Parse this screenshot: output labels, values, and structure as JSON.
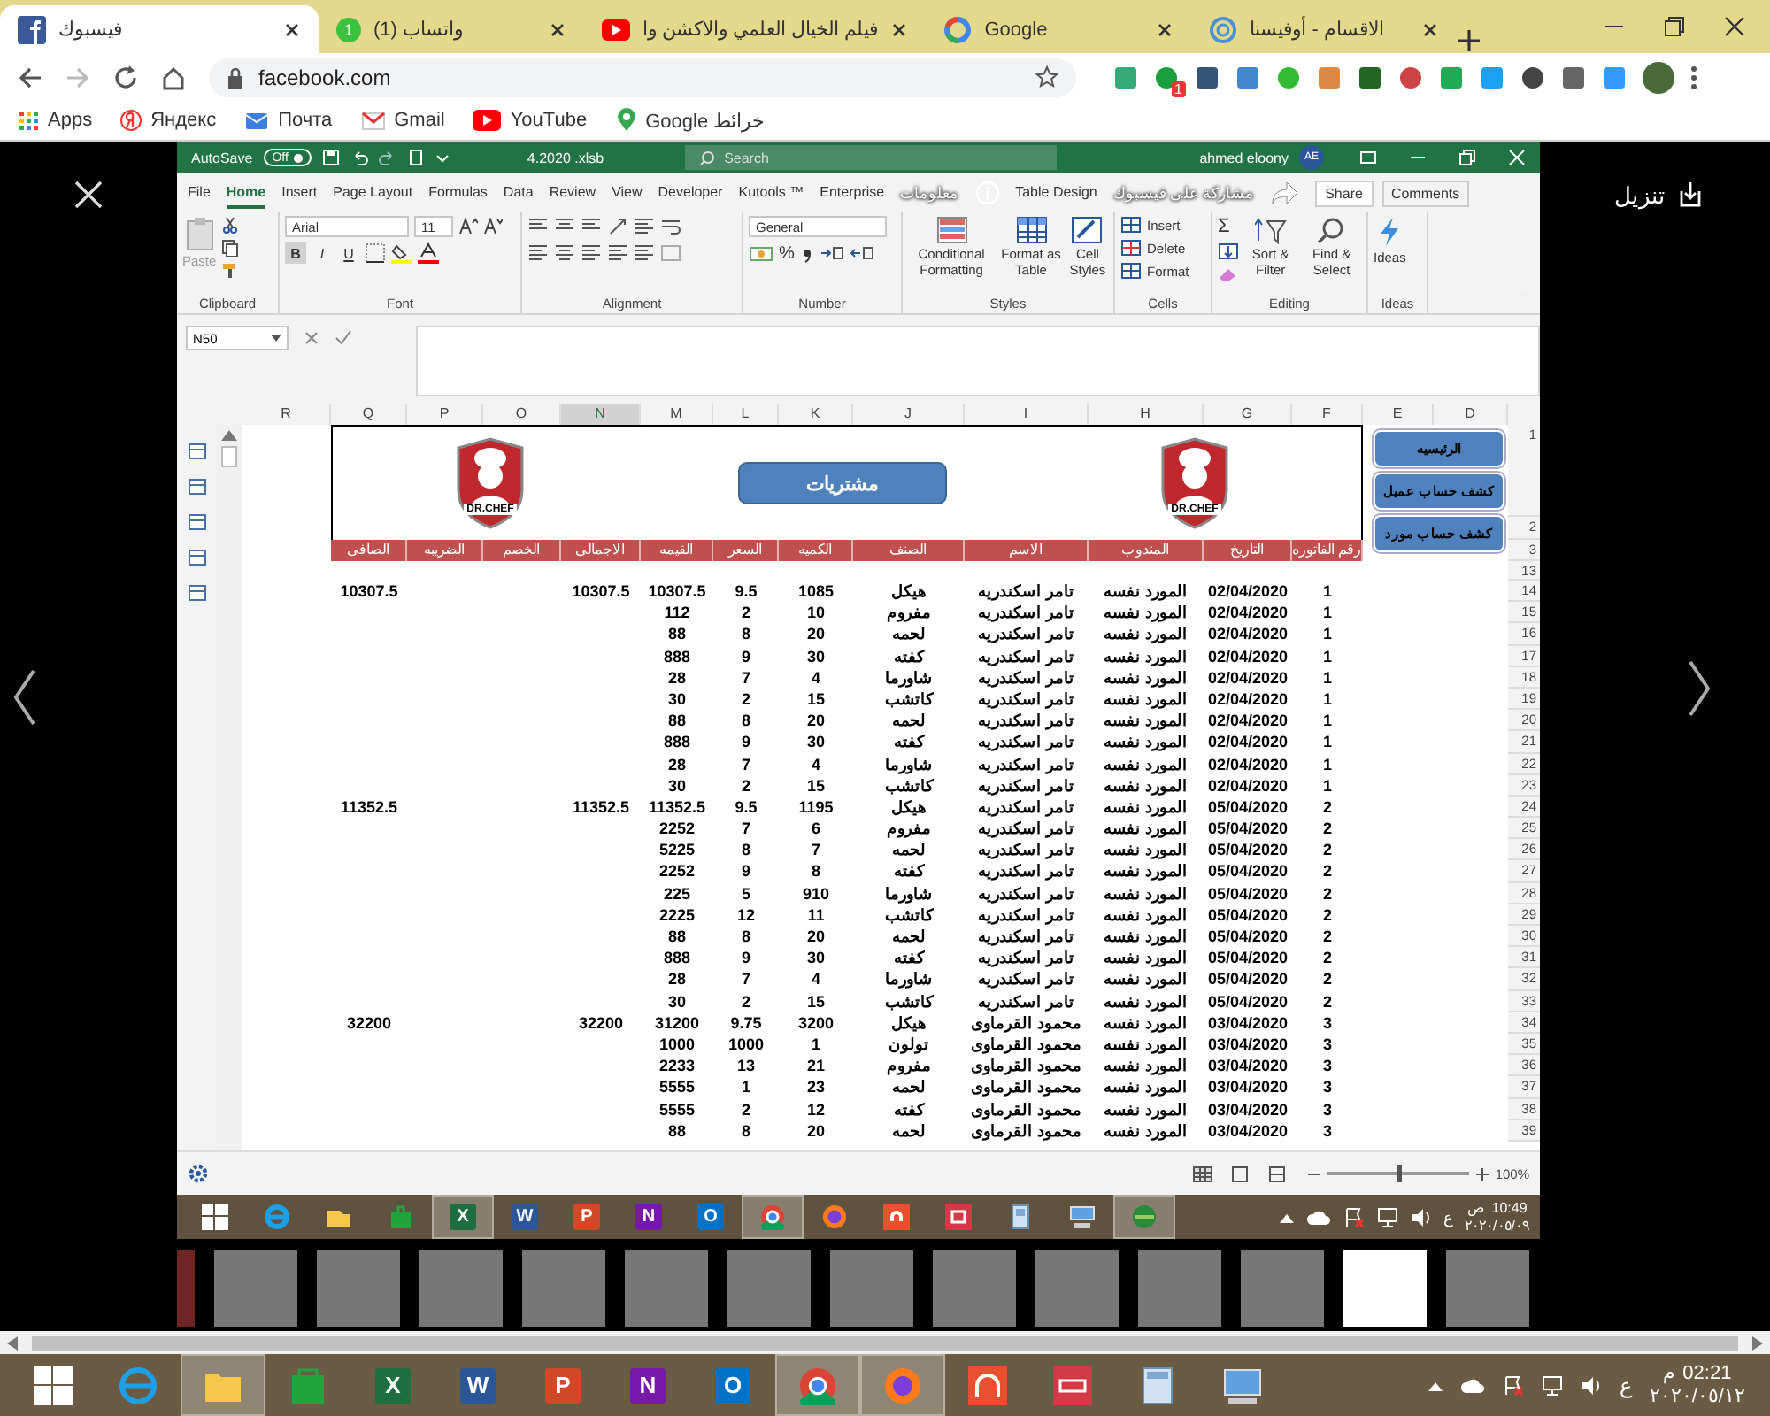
{
  "browser": {
    "tabs": [
      {
        "title": "الاقسام - أوفيسنا",
        "kind": "spiral",
        "selected": false
      },
      {
        "title": "Google",
        "kind": "ring",
        "selected": false
      },
      {
        "title": "فيلم الخيال العلمي والاكشن وا",
        "kind": "play",
        "selected": false
      },
      {
        "title": "(1) واتساب",
        "kind": "badge",
        "badge": "1",
        "selected": false
      },
      {
        "title": "فيسبوك",
        "kind": "square",
        "selected": true
      }
    ],
    "address": "facebook.com",
    "extension_badge": "1",
    "bookmarks": [
      {
        "label": "Google خرائط",
        "kind": "pin"
      },
      {
        "label": "YouTube",
        "kind": "play"
      },
      {
        "label": "Gmail",
        "kind": "gmail"
      },
      {
        "label": "Почта",
        "kind": "mail"
      },
      {
        "label": "Яндекс",
        "kind": "ya"
      },
      {
        "label": "Apps",
        "kind": "grid"
      }
    ]
  },
  "viewer": {
    "download": "تنزيل",
    "info": "معلومات",
    "share": "مشاركة على فيسبوك",
    "thumbnails": [
      {
        "selected": false
      },
      {
        "selected": false
      },
      {
        "selected": false
      },
      {
        "selected": false
      },
      {
        "selected": false
      },
      {
        "selected": false
      },
      {
        "selected": false
      },
      {
        "selected": false
      },
      {
        "selected": false
      },
      {
        "selected": false
      },
      {
        "selected": false
      },
      {
        "selected": false
      },
      {
        "selected": true
      },
      {
        "selected": false
      }
    ]
  },
  "excel": {
    "title_bar": {
      "autosave": "AutoSave",
      "autosave_state": "Off",
      "file": "4.2020 .xlsb",
      "search": "Search",
      "user": "ahmed eloony",
      "initials": "AE"
    },
    "tabs": [
      {
        "label": "Table Design",
        "selected": false
      },
      {
        "label": "Enterprise",
        "selected": false
      },
      {
        "label": "Kutools ™",
        "selected": false
      },
      {
        "label": "Developer",
        "selected": false
      },
      {
        "label": "View",
        "selected": false
      },
      {
        "label": "Review",
        "selected": false
      },
      {
        "label": "Data",
        "selected": false
      },
      {
        "label": "Formulas",
        "selected": false
      },
      {
        "label": "Page Layout",
        "selected": false
      },
      {
        "label": "Insert",
        "selected": false
      },
      {
        "label": "Home",
        "selected": true
      },
      {
        "label": "File",
        "selected": false
      }
    ],
    "share": "Share",
    "comments": "Comments",
    "ribbon": {
      "clipboard": {
        "paste": "Paste",
        "label": "Clipboard"
      },
      "font": {
        "name": "Arial",
        "size": "11",
        "bold": "B",
        "italic": "I",
        "underline": "U",
        "label": "Font"
      },
      "alignment": {
        "label": "Alignment"
      },
      "number": {
        "format": "General",
        "percent": "%",
        "label": "Number"
      },
      "styles": {
        "buttons": [
          "Cell Styles",
          "Format as Table",
          "Conditional Formatting"
        ],
        "label": "Styles"
      },
      "cells": {
        "buttons": [
          "Insert",
          "Delete",
          "Format"
        ],
        "label": "Cells"
      },
      "editing": {
        "sum": "Σ",
        "buttons": [
          "Find & Select",
          "Sort & Filter"
        ],
        "label": "Editing"
      },
      "ideas": {
        "button": "Ideas",
        "label": "Ideas"
      }
    },
    "name_box": "N50",
    "columns": [
      {
        "letter": "D",
        "selected": false
      },
      {
        "letter": "E",
        "selected": false
      },
      {
        "letter": "F",
        "selected": false
      },
      {
        "letter": "G",
        "selected": false
      },
      {
        "letter": "H",
        "selected": false
      },
      {
        "letter": "I",
        "selected": false
      },
      {
        "letter": "J",
        "selected": false
      },
      {
        "letter": "K",
        "selected": false
      },
      {
        "letter": "L",
        "selected": false
      },
      {
        "letter": "M",
        "selected": false
      },
      {
        "letter": "N",
        "selected": true
      },
      {
        "letter": "O",
        "selected": false
      },
      {
        "letter": "P",
        "selected": false
      },
      {
        "letter": "Q",
        "selected": false
      },
      {
        "letter": "R",
        "selected": false
      }
    ],
    "sheet": {
      "title": "مشتريات",
      "logo_text": [
        "DR.CHEF",
        "DR.CHEF"
      ],
      "buttons": [
        "الرئيسيه",
        "كشف حساب عميل",
        "كشف حساب مورد"
      ],
      "headers": [
        "رقم الفاتوره",
        "التاريخ",
        "المندوب",
        "الاسم",
        "الصنف",
        "الكميه",
        "السعر",
        "القيمه",
        "الاجمالى",
        "الخصم",
        "الضريبه",
        "الصافى"
      ],
      "header_rows": [
        "1",
        "2",
        "3",
        "13"
      ],
      "rows": [
        {
          "row": "14",
          "invoice": "1",
          "date": "02/04/2020",
          "rep": "المورد نفسه",
          "name": "تامر اسكندريه",
          "item": "هيكل",
          "qty": "1085",
          "price": "9.5",
          "value": "10307.5",
          "total": "10307.5",
          "net": "10307.5"
        },
        {
          "row": "15",
          "invoice": "1",
          "date": "02/04/2020",
          "rep": "المورد نفسه",
          "name": "تامر اسكندريه",
          "item": "مفروم",
          "qty": "10",
          "price": "2",
          "value": "112"
        },
        {
          "row": "16",
          "invoice": "1",
          "date": "02/04/2020",
          "rep": "المورد نفسه",
          "name": "تامر اسكندريه",
          "item": "لحمه",
          "qty": "20",
          "price": "8",
          "value": "88"
        },
        {
          "row": "17",
          "invoice": "1",
          "date": "02/04/2020",
          "rep": "المورد نفسه",
          "name": "تامر اسكندريه",
          "item": "كفته",
          "qty": "30",
          "price": "9",
          "value": "888"
        },
        {
          "row": "18",
          "invoice": "1",
          "date": "02/04/2020",
          "rep": "المورد نفسه",
          "name": "تامر اسكندريه",
          "item": "شاورما",
          "qty": "4",
          "price": "7",
          "value": "28"
        },
        {
          "row": "19",
          "invoice": "1",
          "date": "02/04/2020",
          "rep": "المورد نفسه",
          "name": "تامر اسكندريه",
          "item": "كاتشب",
          "qty": "15",
          "price": "2",
          "value": "30"
        },
        {
          "row": "20",
          "invoice": "1",
          "date": "02/04/2020",
          "rep": "المورد نفسه",
          "name": "تامر اسكندريه",
          "item": "لحمه",
          "qty": "20",
          "price": "8",
          "value": "88"
        },
        {
          "row": "21",
          "invoice": "1",
          "date": "02/04/2020",
          "rep": "المورد نفسه",
          "name": "تامر اسكندريه",
          "item": "كفته",
          "qty": "30",
          "price": "9",
          "value": "888"
        },
        {
          "row": "22",
          "invoice": "1",
          "date": "02/04/2020",
          "rep": "المورد نفسه",
          "name": "تامر اسكندريه",
          "item": "شاورما",
          "qty": "4",
          "price": "7",
          "value": "28"
        },
        {
          "row": "23",
          "invoice": "1",
          "date": "02/04/2020",
          "rep": "المورد نفسه",
          "name": "تامر اسكندريه",
          "item": "كاتشب",
          "qty": "15",
          "price": "2",
          "value": "30"
        },
        {
          "row": "24",
          "invoice": "2",
          "date": "05/04/2020",
          "rep": "المورد نفسه",
          "name": "تامر اسكندريه",
          "item": "هيكل",
          "qty": "1195",
          "price": "9.5",
          "value": "11352.5",
          "total": "11352.5",
          "net": "11352.5"
        },
        {
          "row": "25",
          "invoice": "2",
          "date": "05/04/2020",
          "rep": "المورد نفسه",
          "name": "تامر اسكندريه",
          "item": "مفروم",
          "qty": "6",
          "price": "7",
          "value": "2252"
        },
        {
          "row": "26",
          "invoice": "2",
          "date": "05/04/2020",
          "rep": "المورد نفسه",
          "name": "تامر اسكندريه",
          "item": "لحمه",
          "qty": "7",
          "price": "8",
          "value": "5225"
        },
        {
          "row": "27",
          "invoice": "2",
          "date": "05/04/2020",
          "rep": "المورد نفسه",
          "name": "تامر اسكندريه",
          "item": "كفته",
          "qty": "8",
          "price": "9",
          "value": "2252"
        },
        {
          "row": "28",
          "invoice": "2",
          "date": "05/04/2020",
          "rep": "المورد نفسه",
          "name": "تامر اسكندريه",
          "item": "شاورما",
          "qty": "910",
          "price": "5",
          "value": "225"
        },
        {
          "row": "29",
          "invoice": "2",
          "date": "05/04/2020",
          "rep": "المورد نفسه",
          "name": "تامر اسكندريه",
          "item": "كاتشب",
          "qty": "11",
          "price": "12",
          "value": "2225"
        },
        {
          "row": "30",
          "invoice": "2",
          "date": "05/04/2020",
          "rep": "المورد نفسه",
          "name": "تامر اسكندريه",
          "item": "لحمه",
          "qty": "20",
          "price": "8",
          "value": "88"
        },
        {
          "row": "31",
          "invoice": "2",
          "date": "05/04/2020",
          "rep": "المورد نفسه",
          "name": "تامر اسكندريه",
          "item": "كفته",
          "qty": "30",
          "price": "9",
          "value": "888"
        },
        {
          "row": "32",
          "invoice": "2",
          "date": "05/04/2020",
          "rep": "المورد نفسه",
          "name": "تامر اسكندريه",
          "item": "شاورما",
          "qty": "4",
          "price": "7",
          "value": "28"
        },
        {
          "row": "33",
          "invoice": "2",
          "date": "05/04/2020",
          "rep": "المورد نفسه",
          "name": "تامر اسكندريه",
          "item": "كاتشب",
          "qty": "15",
          "price": "2",
          "value": "30"
        },
        {
          "row": "34",
          "invoice": "3",
          "date": "03/04/2020",
          "rep": "المورد نفسه",
          "name": "محمود القرماوى",
          "item": "هيكل",
          "qty": "3200",
          "price": "9.75",
          "value": "31200",
          "total": "32200",
          "net": "32200"
        },
        {
          "row": "35",
          "invoice": "3",
          "date": "03/04/2020",
          "rep": "المورد نفسه",
          "name": "محمود القرماوى",
          "item": "تولون",
          "qty": "1",
          "price": "1000",
          "value": "1000"
        },
        {
          "row": "36",
          "invoice": "3",
          "date": "03/04/2020",
          "rep": "المورد نفسه",
          "name": "محمود القرماوى",
          "item": "مفروم",
          "qty": "21",
          "price": "13",
          "value": "2233"
        },
        {
          "row": "37",
          "invoice": "3",
          "date": "03/04/2020",
          "rep": "المورد نفسه",
          "name": "محمود القرماوى",
          "item": "لحمه",
          "qty": "23",
          "price": "1",
          "value": "5555"
        },
        {
          "row": "38",
          "invoice": "3",
          "date": "03/04/2020",
          "rep": "المورد نفسه",
          "name": "محمود القرماوى",
          "item": "كفته",
          "qty": "12",
          "price": "2",
          "value": "5555"
        },
        {
          "row": "39",
          "invoice": "3",
          "date": "03/04/2020",
          "rep": "المورد نفسه",
          "name": "محمود القرماوى",
          "item": "لحمه",
          "qty": "20",
          "price": "8",
          "value": "88"
        }
      ]
    },
    "status": {
      "zoom": "100%",
      "zoom_slider": {
        "level": 0.5
      }
    },
    "taskbar": {
      "apps": [
        {
          "kind": "globe",
          "active": true
        },
        {
          "kind": "pc",
          "active": false
        },
        {
          "kind": "calc",
          "active": false
        },
        {
          "kind": "media",
          "active": false
        },
        {
          "kind": "music",
          "active": false
        },
        {
          "kind": "firefox",
          "active": false
        },
        {
          "kind": "chrome",
          "active": true
        },
        {
          "kind": "outlook",
          "glyph": "O",
          "active": false
        },
        {
          "kind": "onenote",
          "glyph": "N",
          "active": false
        },
        {
          "kind": "ppt",
          "glyph": "P",
          "active": false
        },
        {
          "kind": "word",
          "glyph": "W",
          "active": false
        },
        {
          "kind": "excel",
          "glyph": "X",
          "active": true
        },
        {
          "kind": "store",
          "active": false
        },
        {
          "kind": "explorer",
          "active": false
        },
        {
          "kind": "ie",
          "active": false
        },
        {
          "kind": "start",
          "active": false
        }
      ],
      "lang": "ع",
      "time": "10:49",
      "period": "ص",
      "date": "٢٠٢٠/٠٥/٠٩"
    }
  },
  "taskbar": {
    "apps": [
      {
        "kind": "pc",
        "active": false
      },
      {
        "kind": "calc",
        "active": false
      },
      {
        "kind": "media",
        "active": false
      },
      {
        "kind": "music",
        "active": false
      },
      {
        "kind": "firefox",
        "active": true
      },
      {
        "kind": "chrome",
        "active": true
      },
      {
        "kind": "outlook",
        "glyph": "O",
        "active": false
      },
      {
        "kind": "onenote",
        "glyph": "N",
        "active": false
      },
      {
        "kind": "ppt",
        "glyph": "P",
        "active": false
      },
      {
        "kind": "word",
        "glyph": "W",
        "active": false
      },
      {
        "kind": "excel",
        "glyph": "X",
        "active": false
      },
      {
        "kind": "store",
        "active": false
      },
      {
        "kind": "explorer",
        "active": true
      },
      {
        "kind": "ie",
        "active": false
      },
      {
        "kind": "start",
        "active": false
      }
    ],
    "lang": "ع",
    "time": "02:21",
    "period": "م",
    "date": "٢٠٢٠/٠٥/١٢"
  }
}
